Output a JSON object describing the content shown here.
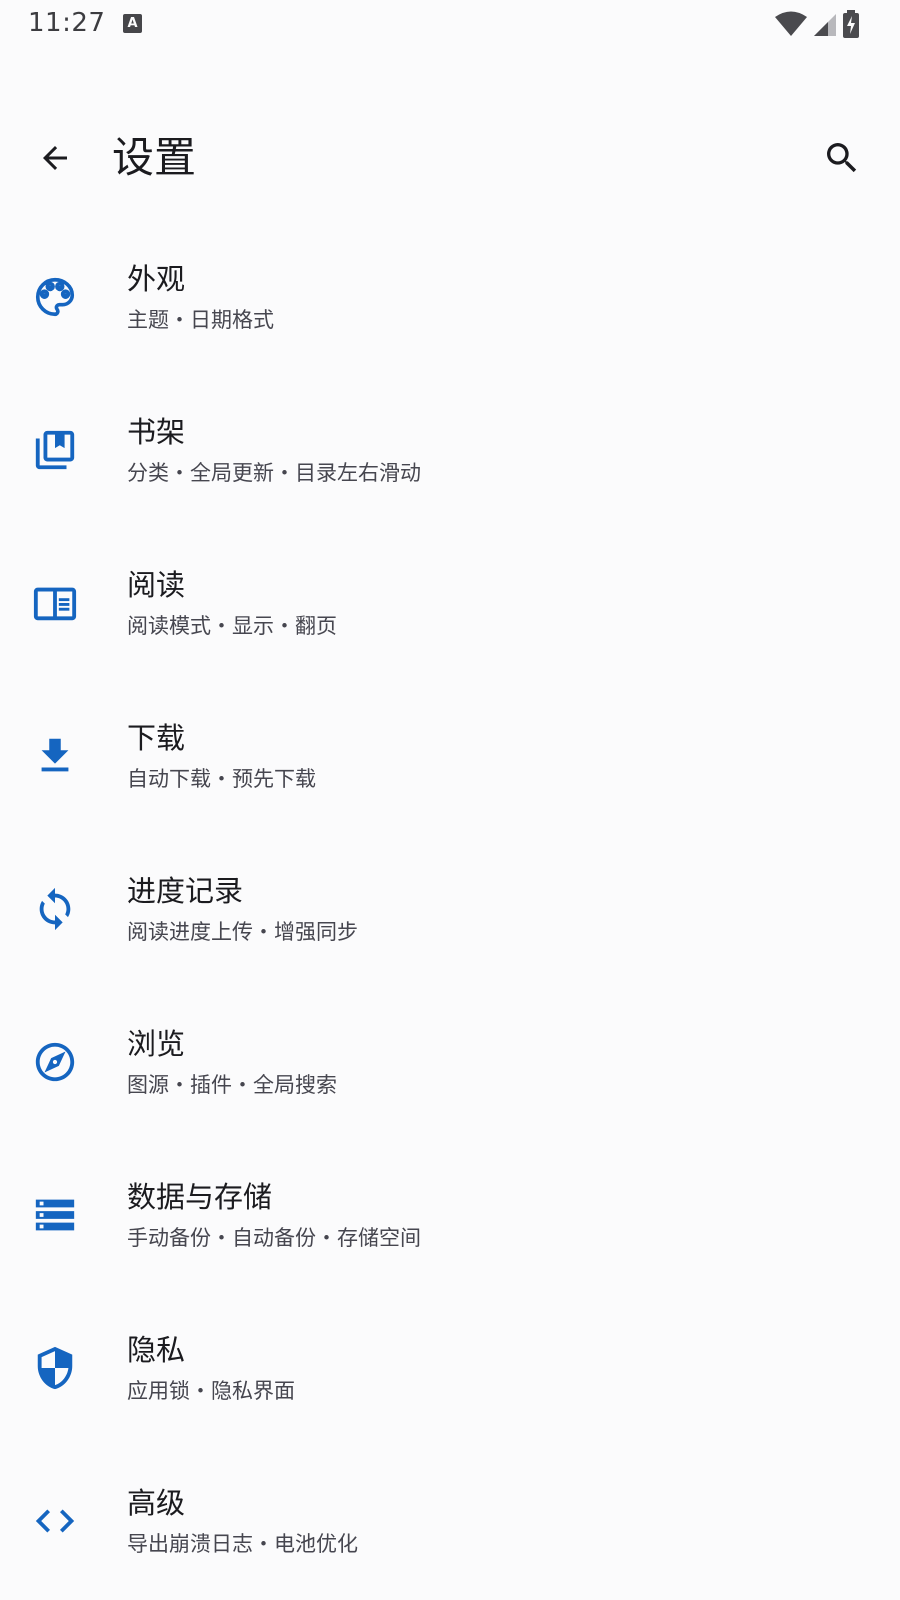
{
  "status_bar": {
    "time": "11:27",
    "notification_icon_letter": "A"
  },
  "top_bar": {
    "title": "设置"
  },
  "colors": {
    "accent": "#1565c0",
    "text_primary": "#1b1b1f",
    "text_secondary": "#46464f",
    "background": "#fbfbfc"
  },
  "settings": [
    {
      "icon": "palette-icon",
      "title": "外观",
      "subtitle": "主题・日期格式"
    },
    {
      "icon": "bookshelf-icon",
      "title": "书架",
      "subtitle": "分类・全局更新・目录左右滑动"
    },
    {
      "icon": "reader-icon",
      "title": "阅读",
      "subtitle": "阅读模式・显示・翻页"
    },
    {
      "icon": "download-icon",
      "title": "下载",
      "subtitle": "自动下载・预先下载"
    },
    {
      "icon": "sync-icon",
      "title": "进度记录",
      "subtitle": "阅读进度上传・增强同步"
    },
    {
      "icon": "compass-icon",
      "title": "浏览",
      "subtitle": "图源・插件・全局搜索"
    },
    {
      "icon": "storage-icon",
      "title": "数据与存储",
      "subtitle": "手动备份・自动备份・存储空间"
    },
    {
      "icon": "shield-icon",
      "title": "隐私",
      "subtitle": "应用锁・隐私界面"
    },
    {
      "icon": "code-icon",
      "title": "高级",
      "subtitle": "导出崩溃日志・电池优化"
    }
  ]
}
